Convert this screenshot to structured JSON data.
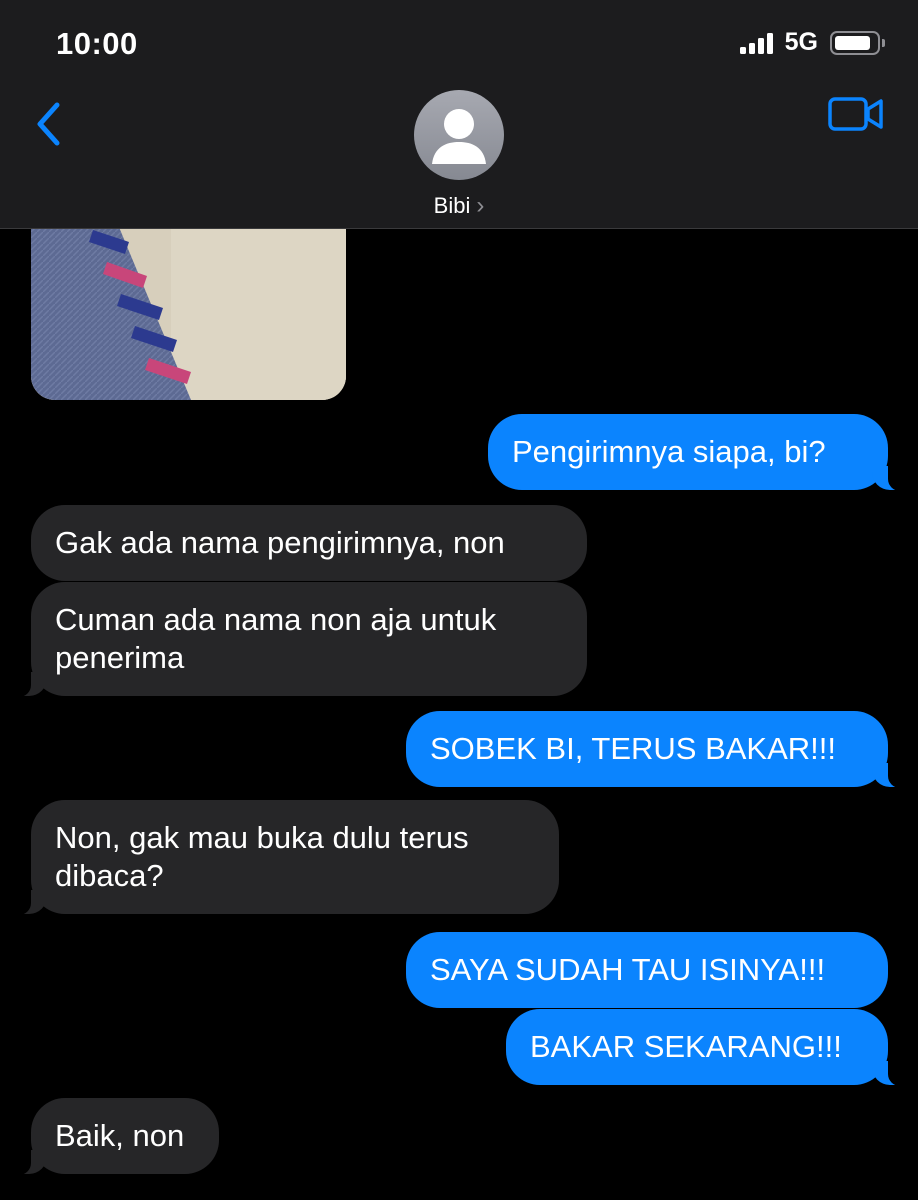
{
  "status_bar": {
    "time": "10:00",
    "network": "5G",
    "battery_level": 0.9,
    "signal_bars": 4
  },
  "header": {
    "back_icon": "chevron-left-icon",
    "contact_name": "Bibi",
    "video_icon": "video-camera-icon",
    "accent_color": "#0b84fe"
  },
  "messages": [
    {
      "direction": "outgoing",
      "text": "Pengirimnya siapa, bi?"
    },
    {
      "direction": "incoming",
      "text": "Gak ada nama pengirimnya, non"
    },
    {
      "direction": "incoming",
      "text": "Cuman ada nama non aja untuk penerima"
    },
    {
      "direction": "outgoing",
      "text": "SOBEK BI, TERUS BAKAR!!!"
    },
    {
      "direction": "incoming",
      "text": "Non, gak mau buka dulu terus dibaca?"
    },
    {
      "direction": "outgoing",
      "text": "SAYA SUDAH TAU ISINYA!!!"
    },
    {
      "direction": "outgoing",
      "text": "BAKAR SEKARANG!!!"
    },
    {
      "direction": "incoming",
      "text": "Baik, non"
    }
  ],
  "colors": {
    "incoming_bubble": "#262628",
    "outgoing_bubble": "#0b84fe",
    "header_bg": "#1c1c1e"
  }
}
